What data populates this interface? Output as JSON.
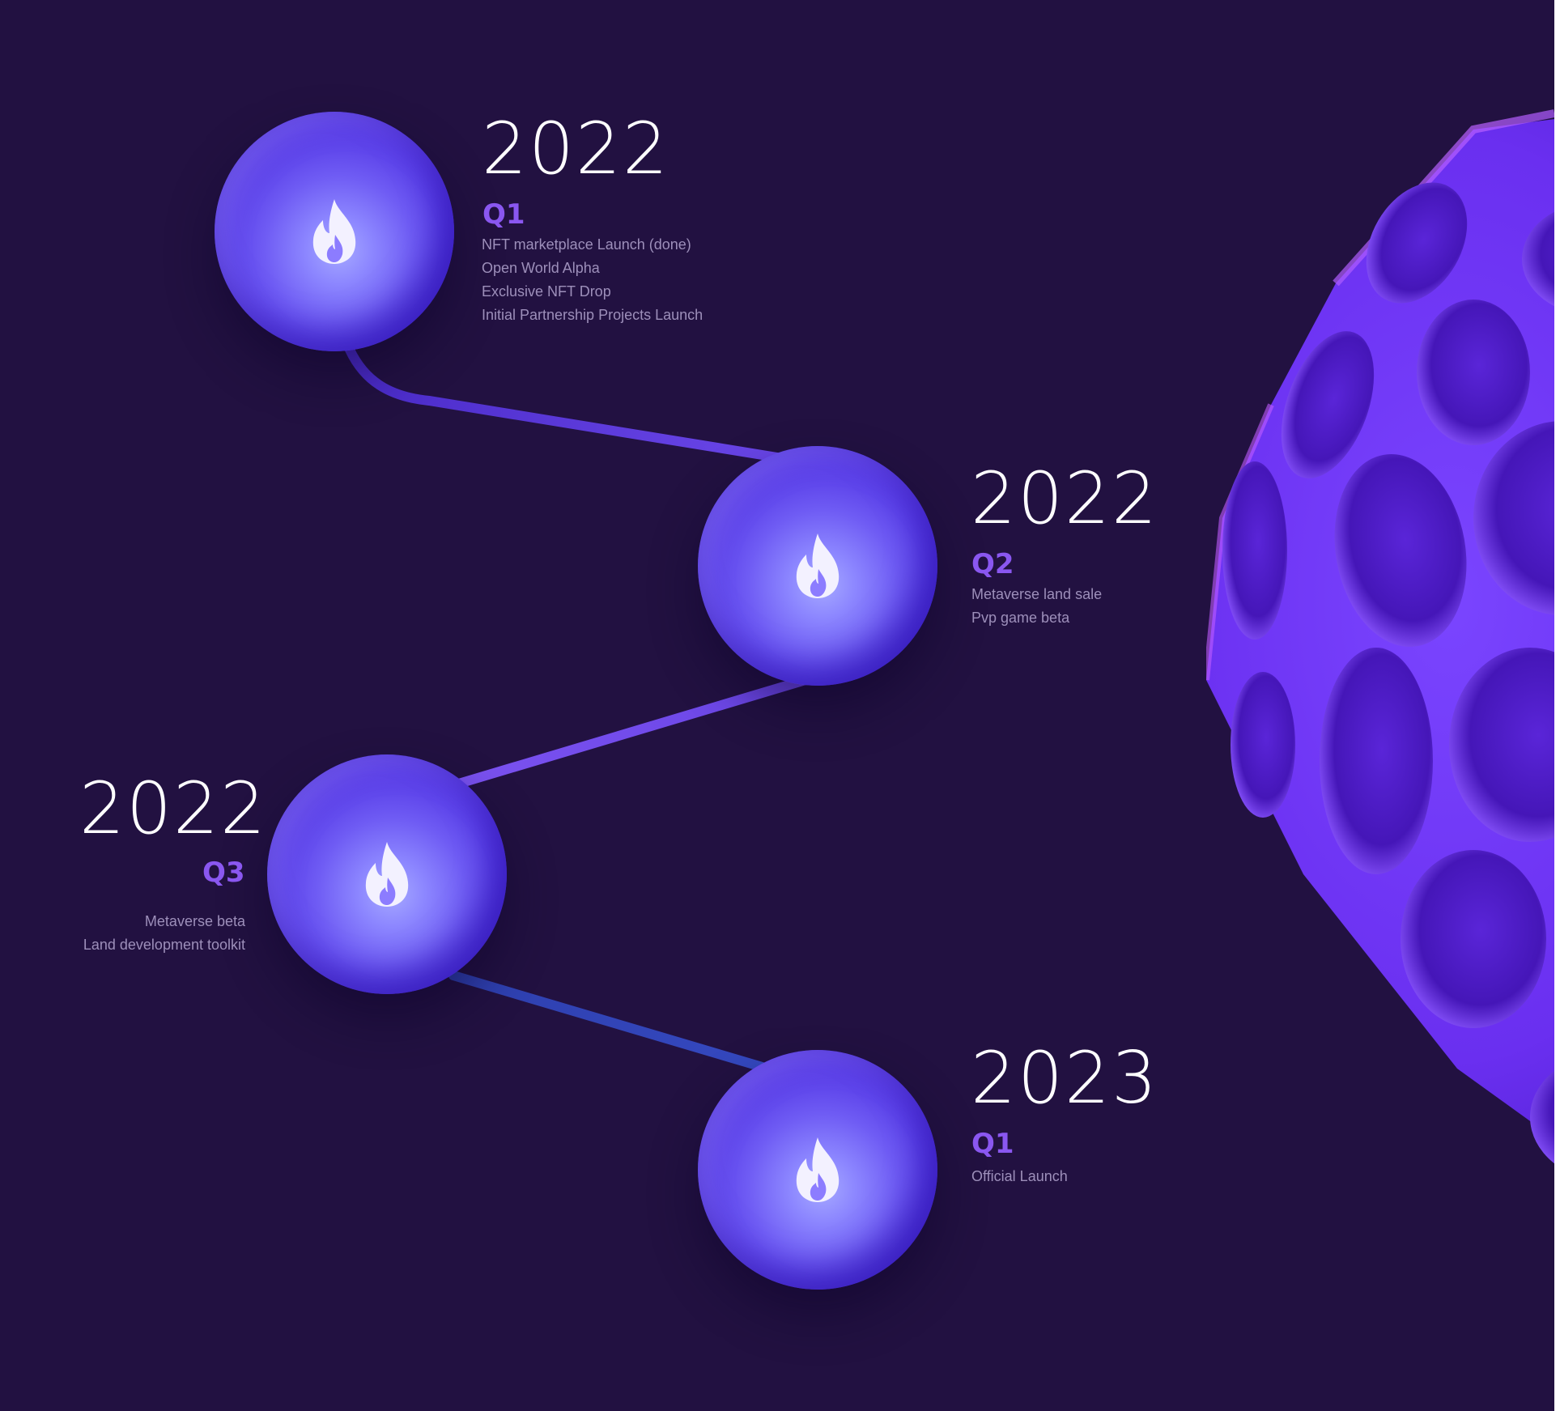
{
  "roadmap": [
    {
      "year": "2022",
      "quarter": "Q1",
      "items": [
        "NFT marketplace Launch (done)",
        "Open World Alpha",
        "Exclusive NFT Drop",
        "Initial Partnership Projects Launch"
      ]
    },
    {
      "year": "2022",
      "quarter": "Q2",
      "items": [
        "Metaverse land sale",
        "Pvp game beta"
      ]
    },
    {
      "year": "2022",
      "quarter": "Q3",
      "items": [
        "Metaverse beta",
        "Land development toolkit"
      ]
    },
    {
      "year": "2023",
      "quarter": "Q1",
      "items": [
        "Official Launch"
      ]
    }
  ],
  "colors": {
    "background": "#221141",
    "quarter_accent": "#8a57f0",
    "item_text": "#9d8fba",
    "sphere_light": "#a6a9ff",
    "sphere_dark": "#2c0bc2"
  },
  "icons": {
    "milestone": "flame-icon",
    "decoration": "porous-planet"
  }
}
